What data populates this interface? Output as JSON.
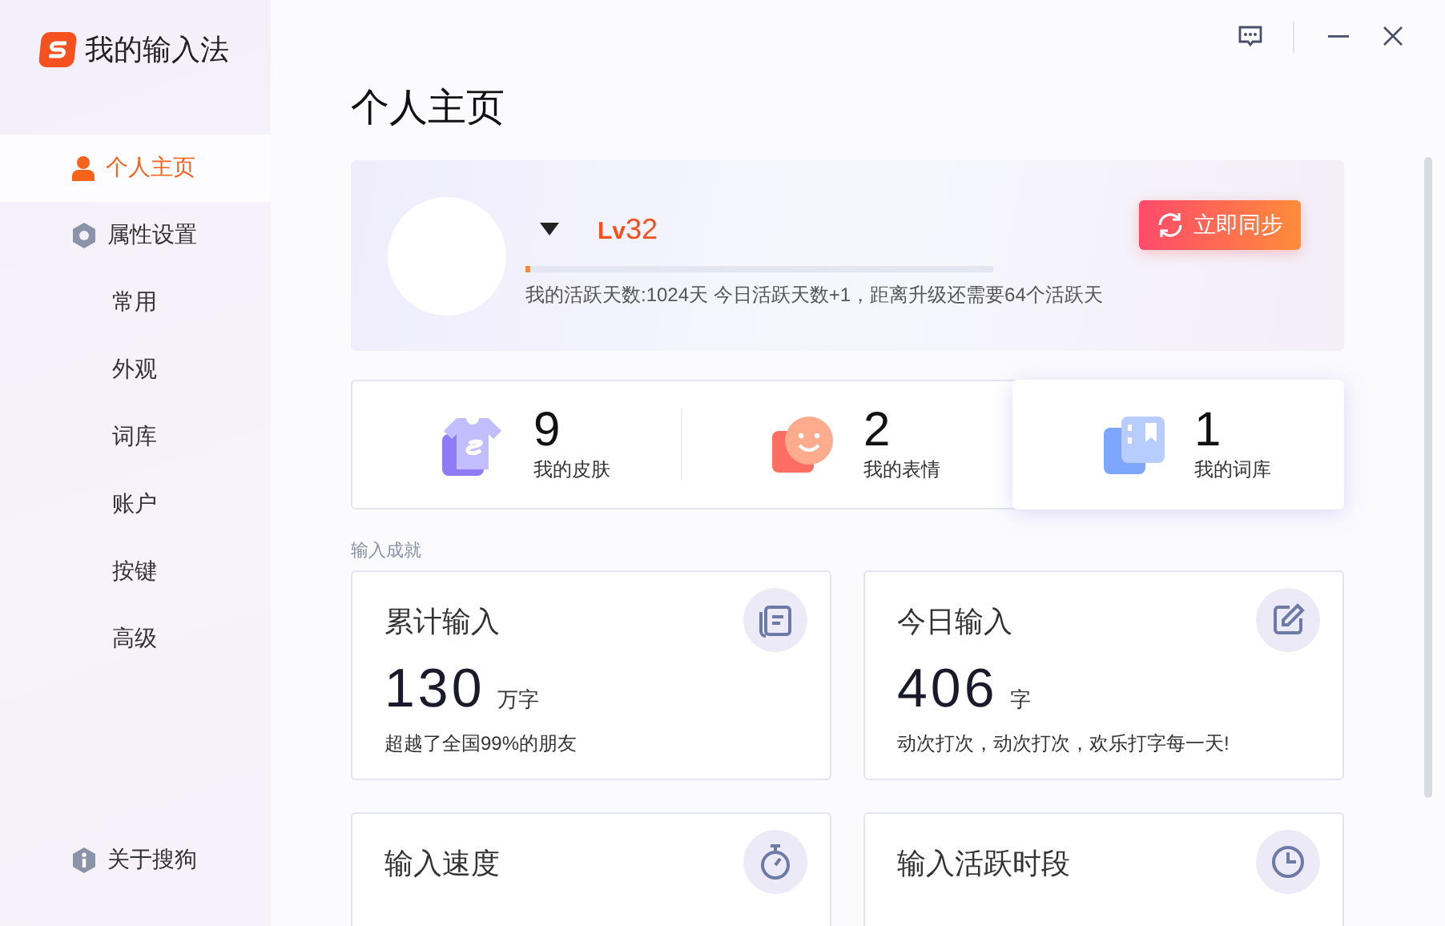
{
  "app": {
    "title": "我的输入法"
  },
  "sidebar": {
    "items": [
      {
        "label": "个人主页",
        "kind": "profile",
        "selected": true
      },
      {
        "label": "属性设置",
        "kind": "settings",
        "selected": false
      },
      {
        "label": "常用",
        "kind": "sub",
        "selected": false
      },
      {
        "label": "外观",
        "kind": "sub",
        "selected": false
      },
      {
        "label": "词库",
        "kind": "sub",
        "selected": false
      },
      {
        "label": "账户",
        "kind": "sub",
        "selected": false
      },
      {
        "label": "按键",
        "kind": "sub",
        "selected": false
      },
      {
        "label": "高级",
        "kind": "sub",
        "selected": false
      }
    ],
    "footer": {
      "label": "关于搜狗"
    }
  },
  "page_title": "个人主页",
  "profile": {
    "level_badge": "**Lv**32",
    "progress": {
      "level": 0.01
    },
    "status": "我的活跃天数:1024天 今日活跃天数+1，距离升级还需要64个活跃天",
    "sync_button": "立即同步"
  },
  "stats": [
    {
      "count": "9",
      "label": "我的皮肤",
      "kind": "skin",
      "selected": false
    },
    {
      "count": "2",
      "label": "我的表情",
      "kind": "emoji",
      "selected": false
    },
    {
      "count": "1",
      "label": "我的词库",
      "kind": "dict",
      "selected": true
    }
  ],
  "section_title": "输入成就",
  "achievements": [
    {
      "title": "累计输入",
      "value": "130",
      "unit": "万字",
      "note": "超越了全国99%的朋友",
      "kind": "doc"
    },
    {
      "title": "今日输入",
      "value": "406",
      "unit": "字",
      "note": "动次打次，动次打次，欢乐打字每一天!",
      "kind": "edit"
    },
    {
      "title": "输入速度",
      "kind": "timer"
    },
    {
      "title": "输入活跃时段",
      "kind": "clock"
    }
  ]
}
